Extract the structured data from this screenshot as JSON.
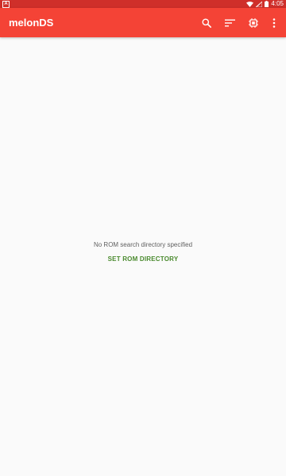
{
  "status_bar": {
    "app_badge": "A",
    "time": "4:05",
    "icons": [
      "wifi-icon",
      "signal-icon",
      "battery-icon"
    ]
  },
  "toolbar": {
    "title": "melonDS",
    "actions": [
      "search-icon",
      "sort-icon",
      "chip-icon",
      "more-vert-icon"
    ],
    "background_color": "#f44336"
  },
  "empty_state": {
    "message": "No ROM search directory specified",
    "button_label": "SET ROM DIRECTORY",
    "button_color": "#4a8a2e"
  }
}
